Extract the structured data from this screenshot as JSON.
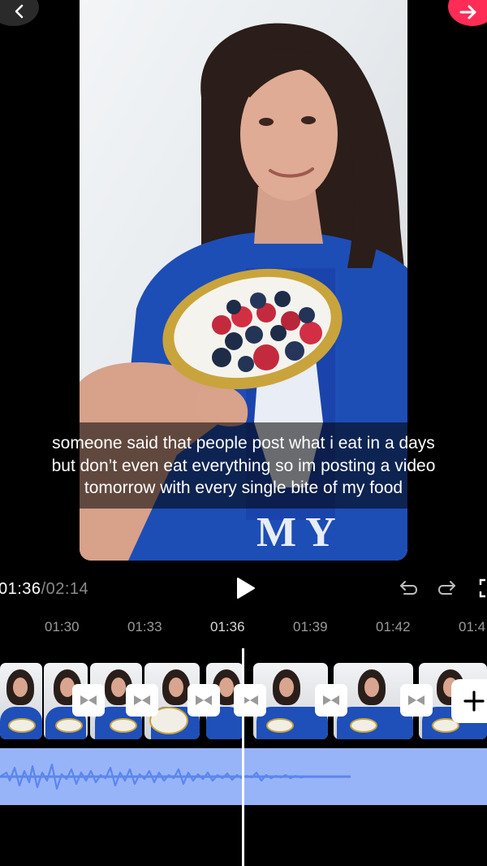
{
  "caption": {
    "line1": "someone said that people post what i eat in a days",
    "line2": "but don’t even eat everything so im posting a video",
    "line3": "tomorrow with every single bite of my food"
  },
  "playback": {
    "current": "01:36",
    "separator": "/",
    "total": "02:14"
  },
  "ruler": [
    "01:30",
    "01:33",
    "01:36",
    "01:39",
    "01:42",
    "01:4"
  ],
  "icons": {
    "back": "chevron-left-icon",
    "next": "arrow-right-icon",
    "play": "play-icon",
    "undo": "undo-icon",
    "redo": "redo-icon",
    "fullscreen": "fullscreen-icon",
    "transition": "transition-icon",
    "add": "plus-icon"
  },
  "colors": {
    "accent": "#ff2c55",
    "audio_track": "#98b4f9",
    "waveform": "#5a86ef",
    "background": "#000000"
  }
}
